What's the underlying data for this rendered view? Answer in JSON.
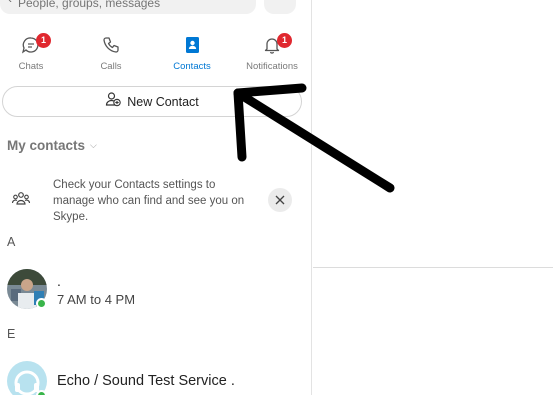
{
  "search": {
    "placeholder": "People, groups, messages"
  },
  "tabs": [
    {
      "label": "Chats",
      "badge": "1",
      "icon": "chat-icon"
    },
    {
      "label": "Calls",
      "icon": "phone-icon"
    },
    {
      "label": "Contacts",
      "icon": "contacts-book-icon",
      "active": true
    },
    {
      "label": "Notifications",
      "badge": "1",
      "icon": "bell-icon"
    }
  ],
  "new_contact": {
    "label": "New Contact",
    "icon": "add-person-icon"
  },
  "section": {
    "title": "My contacts",
    "icon": "chevron-down-icon"
  },
  "notice": {
    "text": "Check your Contacts settings to manage who can find and see you on Skype.",
    "icon": "people-group-icon",
    "close_icon": "close-icon"
  },
  "groups": [
    {
      "letter": "A",
      "contacts": [
        {
          "name": ".",
          "status": "7 AM to 4 PM",
          "online": true
        }
      ]
    },
    {
      "letter": "E",
      "contacts": [
        {
          "name": "Echo / Sound Test Service .",
          "online": true
        }
      ]
    }
  ],
  "colors": {
    "accent": "#0078d4",
    "badge": "#e0282f",
    "online": "#39b54a"
  }
}
